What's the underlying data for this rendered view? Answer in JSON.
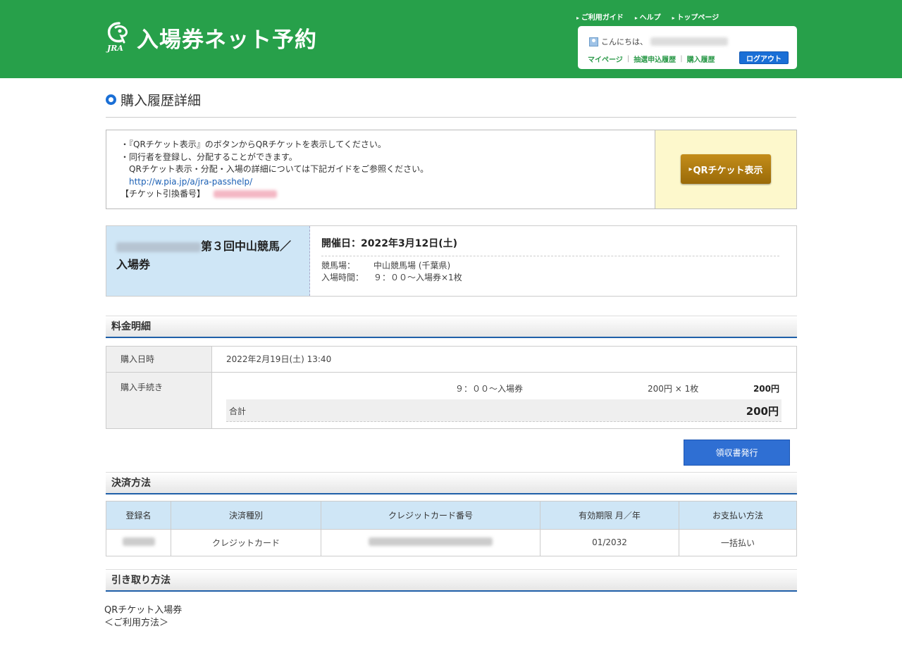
{
  "header": {
    "logo_text": "入場券ネット予約",
    "logo_sub": "JRA",
    "top_links": [
      "ご利用ガイド",
      "ヘルプ",
      "トップページ"
    ],
    "greeting": "こんにちは、",
    "user_links": [
      "マイページ",
      "抽選申込履歴",
      "購入履歴"
    ],
    "logout": "ログアウト"
  },
  "page": {
    "title": "購入履歴詳細"
  },
  "info": {
    "line1": "・『QRチケット表示』のボタンからQRチケットを表示してください。",
    "line2": "・同行者を登録し、分配することができます。",
    "line3": "QRチケット表示・分配・入場の詳細については下記ガイドをご参照ください。",
    "link": "http://w.pia.jp/a/jra-passhelp/",
    "code_label": "【チケット引換番号】",
    "qr_button": "QRチケット表示"
  },
  "event": {
    "name": "第３回中山競馬／入場券",
    "date": "開催日：2022年3月12日(土)",
    "venue_label": "競馬場：",
    "venue": "中山競馬場 (千葉県)",
    "entry_label": "入場時間：",
    "entry": "９：００～入場券×1枚"
  },
  "fee": {
    "section_title": "料金明細",
    "purchase_date_label": "購入日時",
    "purchase_date": "2022年2月19日(土) 13:40",
    "procedure_label": "購入手続き",
    "item_name": "９：００～入場券",
    "item_price": "200円 × 1枚",
    "item_amount": "200円",
    "total_label": "合計",
    "total_amount": "200円",
    "receipt_button": "領収書発行"
  },
  "payment": {
    "section_title": "決済方法",
    "headers": [
      "登録名",
      "決済種別",
      "クレジットカード番号",
      "有効期限 月／年",
      "お支払い方法"
    ],
    "type": "クレジットカード",
    "expiry": "01/2032",
    "method": "一括払い"
  },
  "pickup": {
    "section_title": "引き取り方法",
    "line1": "QRチケット入場券",
    "line2": "＜ご利用方法＞"
  }
}
